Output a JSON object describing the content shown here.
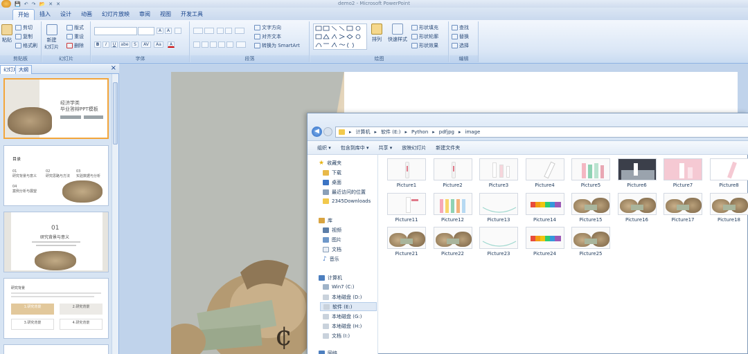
{
  "window": {
    "title": "demo2 - Microsoft PowerPoint"
  },
  "quick_access": [
    "💾",
    "↶",
    "↷",
    "📂",
    "✕",
    "✕"
  ],
  "tabs": [
    "开始",
    "插入",
    "设计",
    "动画",
    "幻灯片放映",
    "审阅",
    "视图",
    "开发工具"
  ],
  "ribbon": {
    "clipboard": {
      "paste": "粘贴",
      "cut": "剪切",
      "copy": "复制",
      "format_painter": "格式刷",
      "label": "剪贴板"
    },
    "slides": {
      "new_slide": "新建\n幻灯片",
      "layout": "版式",
      "reset": "重设",
      "delete": "删除",
      "label": "幻灯片"
    },
    "font": {
      "label": "字体",
      "grow": "A",
      "shrink": "A",
      "bold": "B",
      "italic": "I",
      "underline": "U",
      "strike": "abe",
      "shadow": "S",
      "spacing": "AV",
      "case": "Aa",
      "color": "A"
    },
    "paragraph": {
      "text_direction": "文字方向",
      "align_text": "对齐文本",
      "smartart": "转换为 SmartArt",
      "label": "段落"
    },
    "drawing": {
      "arrange": "排列",
      "quick_styles": "快速样式",
      "shape_fill": "形状填充",
      "shape_outline": "形状轮廓",
      "shape_effects": "形状效果",
      "label": "绘图"
    },
    "editing": {
      "find": "查找",
      "replace": "替换",
      "select": "选择",
      "label": "编辑"
    }
  },
  "pane": {
    "tab_slides": "幻灯片",
    "tab_outline": "大纲",
    "close": "×"
  },
  "thumbs": {
    "t1": {
      "title": "经济学类\n毕业答辩PPT模板",
      "btn1": "",
      "btn2": ""
    },
    "t2": {
      "heading": "目录",
      "items": [
        "研究背景与意义",
        "研究思路与方法",
        "实验数据与分析",
        "案例分析与展望"
      ],
      "nums": [
        "01",
        "02",
        "03",
        "04"
      ]
    },
    "t3": {
      "num": "01",
      "title": "研究背景与意义"
    },
    "t4": {
      "heading": "研究背景",
      "box1": "1.研究背景",
      "box2": "2.研究背景",
      "box3": "3.研究背景",
      "box4": "4.研究背景"
    }
  },
  "explorer": {
    "breadcrumb": [
      "计算机",
      "软件 (E:)",
      "Python",
      "pdfjpg",
      "image"
    ],
    "commands": [
      "组织 ▾",
      "包含到库中 ▾",
      "共享 ▾",
      "放映幻灯片",
      "新建文件夹"
    ],
    "nav": {
      "favorites": "收藏夹",
      "fav_items": [
        "下载",
        "桌面",
        "最近访问的位置",
        "2345Downloads"
      ],
      "libraries": "库",
      "lib_items": [
        "视频",
        "图片",
        "文档",
        "音乐"
      ],
      "computer": "计算机",
      "drives": [
        "Win7 (C:)",
        "本地磁盘 (D:)",
        "软件 (E:)",
        "本地磁盘 (G:)",
        "本地磁盘 (H:)",
        "文档 (I:)"
      ],
      "network": "网络"
    },
    "files": [
      {
        "name": "Picture1",
        "kind": "bottle1"
      },
      {
        "name": "Picture2",
        "kind": "bottle1"
      },
      {
        "name": "Picture3",
        "kind": "bottle2"
      },
      {
        "name": "Picture4",
        "kind": "bottle3"
      },
      {
        "name": "Picture5",
        "kind": "bottles"
      },
      {
        "name": "Picture6",
        "kind": "dark"
      },
      {
        "name": "Picture7",
        "kind": "pink"
      },
      {
        "name": "Picture8",
        "kind": "pink2"
      },
      {
        "name": "Picture11",
        "kind": "bottle4"
      },
      {
        "name": "Picture12",
        "kind": "colors"
      },
      {
        "name": "Picture13",
        "kind": "arc"
      },
      {
        "name": "Picture14",
        "kind": "swatch"
      },
      {
        "name": "Picture15",
        "kind": "money"
      },
      {
        "name": "Picture16",
        "kind": "money"
      },
      {
        "name": "Picture17",
        "kind": "money"
      },
      {
        "name": "Picture18",
        "kind": "money"
      },
      {
        "name": "Picture21",
        "kind": "money"
      },
      {
        "name": "Picture22",
        "kind": "money"
      },
      {
        "name": "Picture23",
        "kind": "arc"
      },
      {
        "name": "Picture24",
        "kind": "swatch"
      },
      {
        "name": "Picture25",
        "kind": "money"
      }
    ]
  },
  "colors": {
    "accent_orange": "#f3a53a",
    "ribbon_blue": "#dbe7f6",
    "border_blue": "#8db2e3"
  }
}
